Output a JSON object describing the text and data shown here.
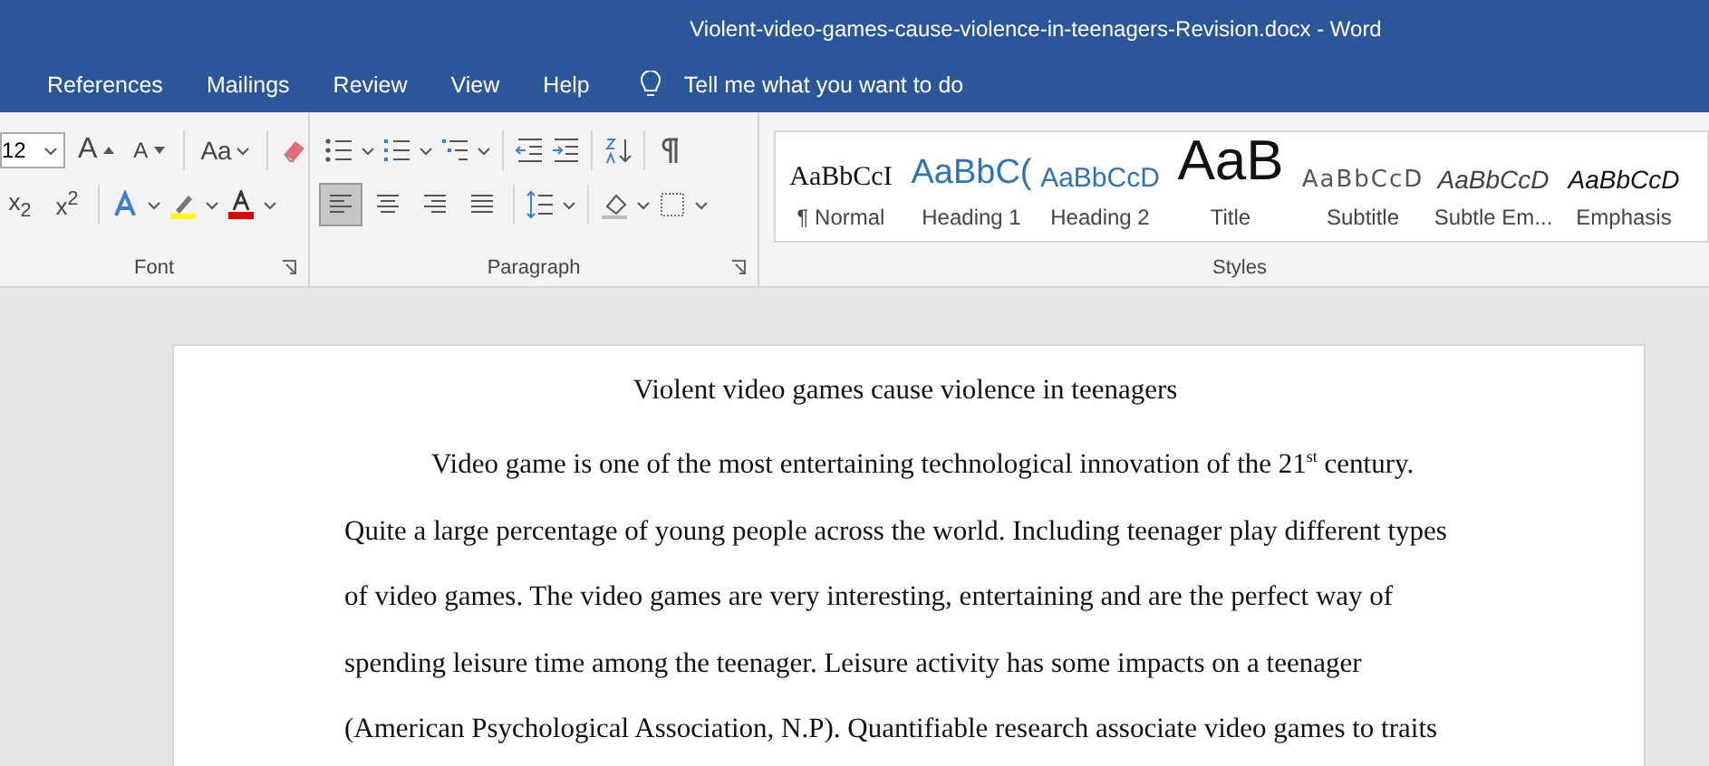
{
  "window": {
    "title": "Violent-video-games-cause-violence-in-teenagers-Revision.docx  -  Word"
  },
  "menu_tabs": [
    {
      "label": "References"
    },
    {
      "label": "Mailings"
    },
    {
      "label": "Review"
    },
    {
      "label": "View"
    },
    {
      "label": "Help"
    }
  ],
  "tell_me": {
    "placeholder": "Tell me what you want to do"
  },
  "font_group": {
    "label": "Font",
    "size": "12",
    "grow": "A",
    "shrink": "A",
    "change_case": "Aa",
    "subscript": "x$_{2}$",
    "superscript": "x$^{2}$"
  },
  "paragraph_group": {
    "label": "Paragraph",
    "alignments": [
      {
        "kind": "left",
        "selected": true
      },
      {
        "kind": "center",
        "selected": false
      },
      {
        "kind": "right",
        "selected": false
      },
      {
        "kind": "justify",
        "selected": false
      }
    ]
  },
  "styles_group": {
    "label": "Styles",
    "styles": [
      {
        "kind": "normal",
        "sample": "AaBbCcI",
        "name": "¶ Normal"
      },
      {
        "kind": "heading1",
        "sample": "AaBbC(",
        "name": "Heading 1"
      },
      {
        "kind": "heading2",
        "sample": "AaBbCcD",
        "name": "Heading 2"
      },
      {
        "kind": "title",
        "sample": "AaB",
        "name": "Title"
      },
      {
        "kind": "subtitle",
        "sample": "AaBbCcD",
        "name": "Subtitle"
      },
      {
        "kind": "subtle",
        "sample": "AaBbCcD",
        "name": "Subtle Em..."
      },
      {
        "kind": "emphasis",
        "sample": "AaBbCcD",
        "name": "Emphasis"
      }
    ]
  },
  "document": {
    "title": "Violent video games cause violence in teenagers",
    "paragraph": "Video game is one of the most entertaining technological innovation of the 21$^{st}$ century. Quite a large percentage of young people across the world. Including teenager play different types of video games. The video games are very interesting, entertaining and are the perfect way of spending leisure time among the teenager. Leisure activity has some impacts on a teenager (American Psychological Association, N.P). Quantifiable research associate video games to traits"
  }
}
